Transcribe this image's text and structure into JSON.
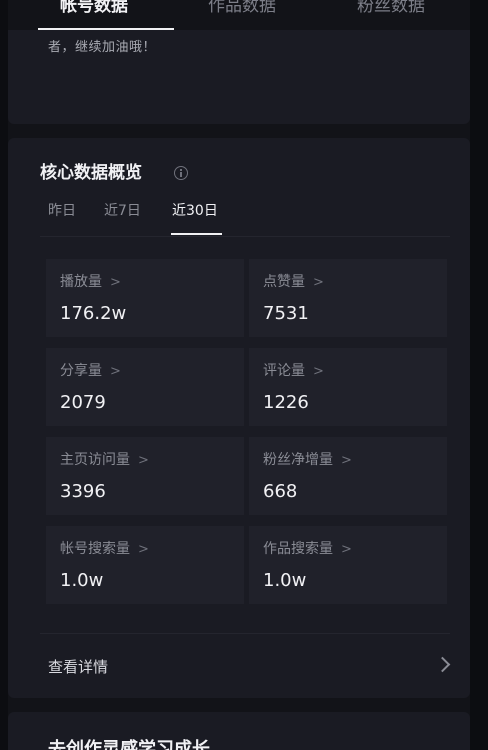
{
  "top_tabs": [
    {
      "label": "帐号数据",
      "active": true
    },
    {
      "label": "作品数据",
      "active": false
    },
    {
      "label": "粉丝数据",
      "active": false
    }
  ],
  "top_card": {
    "text": "者，继续加油哦！"
  },
  "core": {
    "title": "核心数据概览",
    "info_icon": "info-circle-icon",
    "periods": [
      {
        "label": "昨日",
        "active": false
      },
      {
        "label": "近7日",
        "active": false
      },
      {
        "label": "近30日",
        "active": true
      }
    ],
    "metrics": [
      {
        "label": "播放量",
        "value": "176.2w"
      },
      {
        "label": "点赞量",
        "value": "7531"
      },
      {
        "label": "分享量",
        "value": "2079"
      },
      {
        "label": "评论量",
        "value": "1226"
      },
      {
        "label": "主页访问量",
        "value": "3396"
      },
      {
        "label": "粉丝净增量",
        "value": "668"
      },
      {
        "label": "帐号搜索量",
        "value": "1.0w"
      },
      {
        "label": "作品搜索量",
        "value": "1.0w"
      }
    ],
    "metric_chevron": ">",
    "details_label": "查看详情"
  },
  "bottom_card": {
    "title": "去创作灵感学习成长"
  },
  "colors": {
    "background": "#121318",
    "card": "#1a1b23",
    "tile": "#20212a",
    "text_primary": "#f1f1f4",
    "text_secondary": "#8a8c95"
  }
}
